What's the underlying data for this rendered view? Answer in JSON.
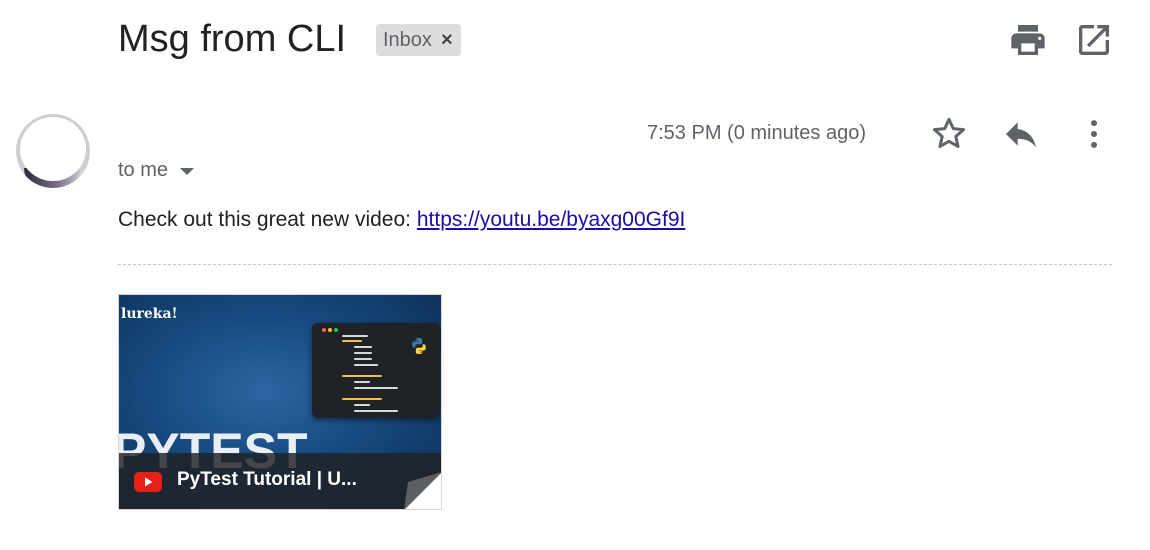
{
  "header": {
    "subject": "Msg from CLI",
    "label": "Inbox",
    "label_remove": "×"
  },
  "message": {
    "timestamp": "7:53 PM (0 minutes ago)",
    "recipient": "to me",
    "body_prefix": "Check out this great new video: ",
    "link_text": "https://youtu.be/byaxg00Gf9I"
  },
  "video_card": {
    "brand_text": "lureka!",
    "big_text": "PYTEST",
    "title": "PyTest Tutorial | U..."
  },
  "icons": {
    "print": "print-icon",
    "popout": "open-in-new-window-icon",
    "star": "star-icon",
    "reply": "reply-icon",
    "more": "more-vertical-icon",
    "caret": "chevron-down-icon",
    "youtube": "youtube-icon"
  },
  "colors": {
    "link": "#1a0dab",
    "chip_bg": "#dddddd",
    "icon_gray": "#5f6368",
    "youtube_red": "#e62117",
    "thumbnail_blue": "#174a80"
  }
}
